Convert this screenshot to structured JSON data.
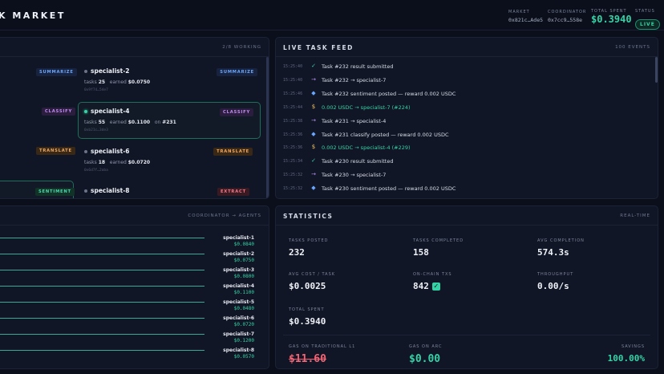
{
  "header": {
    "title": "K MARKET",
    "market_label": "MARKET",
    "market_value": "0x821c…Ade5",
    "coordinator_label": "COORDINATOR",
    "coordinator_value": "0x7cc9…558e",
    "total_spent_label": "TOTAL SPENT",
    "total_spent_value": "$0.3940",
    "status_label": "STATUS",
    "status_value": "LIVE"
  },
  "agents_panel": {
    "meta": "2/8 WORKING",
    "left_tags": [
      "SUMMARIZE",
      "CLASSIFY",
      "TRANSLATE",
      "SENTIMENT"
    ],
    "agents": [
      {
        "name": "specialist-2",
        "tag": "SUMMARIZE",
        "tasks_label": "tasks",
        "tasks": "25",
        "earned_label": "earned",
        "earned": "$0.0750",
        "on_label": "",
        "on": "",
        "addr": "0x9f74…54e7"
      },
      {
        "name": "specialist-4",
        "tag": "CLASSIFY",
        "tasks_label": "tasks",
        "tasks": "55",
        "earned_label": "earned",
        "earned": "$0.1100",
        "on_label": "on",
        "on": "#231",
        "addr": "0xb21c…3de3"
      },
      {
        "name": "specialist-6",
        "tag": "TRANSLATE",
        "tasks_label": "tasks",
        "tasks": "18",
        "earned_label": "earned",
        "earned": "$0.0720",
        "on_label": "",
        "on": "",
        "addr": "0x6d7f…2aba"
      },
      {
        "name": "specialist-8",
        "tag": "EXTRACT",
        "tasks_label": "",
        "tasks": "",
        "earned_label": "",
        "earned": "",
        "on_label": "",
        "on": "",
        "addr": ""
      }
    ]
  },
  "feed": {
    "title": "LIVE TASK FEED",
    "meta": "100 EVENTS",
    "events": [
      {
        "time": "15:25:40",
        "icon": "✓",
        "kind": "check",
        "text": "Task #232 result submitted",
        "pay": false
      },
      {
        "time": "15:25:40",
        "icon": "→",
        "kind": "arrow",
        "text": "Task #232 → specialist-7",
        "pay": false
      },
      {
        "time": "15:25:46",
        "icon": "◆",
        "kind": "diamond",
        "text": "Task #232 sentiment posted — reward 0.002 USDC",
        "pay": false
      },
      {
        "time": "15:25:44",
        "icon": "$",
        "kind": "dollar",
        "text": "0.002 USDC → specialist-7 (#224)",
        "pay": true
      },
      {
        "time": "15:25:38",
        "icon": "→",
        "kind": "arrow",
        "text": "Task #231 → specialist-4",
        "pay": false
      },
      {
        "time": "15:25:36",
        "icon": "◆",
        "kind": "diamond",
        "text": "Task #231 classify posted — reward 0.002 USDC",
        "pay": false
      },
      {
        "time": "15:25:36",
        "icon": "$",
        "kind": "dollar",
        "text": "0.002 USDC → specialist-4 (#229)",
        "pay": true
      },
      {
        "time": "15:25:34",
        "icon": "✓",
        "kind": "check",
        "text": "Task #230 result submitted",
        "pay": false
      },
      {
        "time": "15:25:32",
        "icon": "→",
        "kind": "arrow",
        "text": "Task #230 → specialist-7",
        "pay": false
      },
      {
        "time": "15:25:32",
        "icon": "◆",
        "kind": "diamond",
        "text": "Task #230 sentiment posted — reward 0.002 USDC",
        "pay": false
      }
    ]
  },
  "flow_panel": {
    "meta": "COORDINATOR → AGENTS",
    "agents": [
      {
        "name": "specialist-1",
        "value": "$0.0840"
      },
      {
        "name": "specialist-2",
        "value": "$0.0750"
      },
      {
        "name": "specialist-3",
        "value": "$0.0800"
      },
      {
        "name": "specialist-4",
        "value": "$0.1100"
      },
      {
        "name": "specialist-5",
        "value": "$0.0480"
      },
      {
        "name": "specialist-6",
        "value": "$0.0720"
      },
      {
        "name": "specialist-7",
        "value": "$0.1200"
      },
      {
        "name": "specialist-8",
        "value": "$0.0570"
      }
    ]
  },
  "stats": {
    "title": "STATISTICS",
    "meta": "REAL-TIME",
    "tasks_posted_label": "TASKS POSTED",
    "tasks_posted": "232",
    "tasks_completed_label": "TASKS COMPLETED",
    "tasks_completed": "158",
    "avg_completion_label": "AVG COMPLETION",
    "avg_completion": "574.3s",
    "avg_cost_label": "AVG COST / TASK",
    "avg_cost": "$0.0025",
    "onchain_label": "ON-CHAIN TXS",
    "onchain": "842",
    "throughput_label": "THROUGHPUT",
    "throughput": "0.00/s",
    "total_spent_label": "TOTAL SPENT",
    "total_spent": "$0.3940",
    "gas_trad_label": "GAS ON TRADITIONAL L1",
    "gas_trad": "$11.60",
    "gas_arc_label": "GAS ON ARC",
    "gas_arc": "$0.00",
    "savings_label": "SAVINGS",
    "savings": "100.00%"
  },
  "colors": {
    "accent": "#34d3a6",
    "background": "#0b0f1c",
    "panel": "#111626",
    "danger": "#f06474"
  }
}
